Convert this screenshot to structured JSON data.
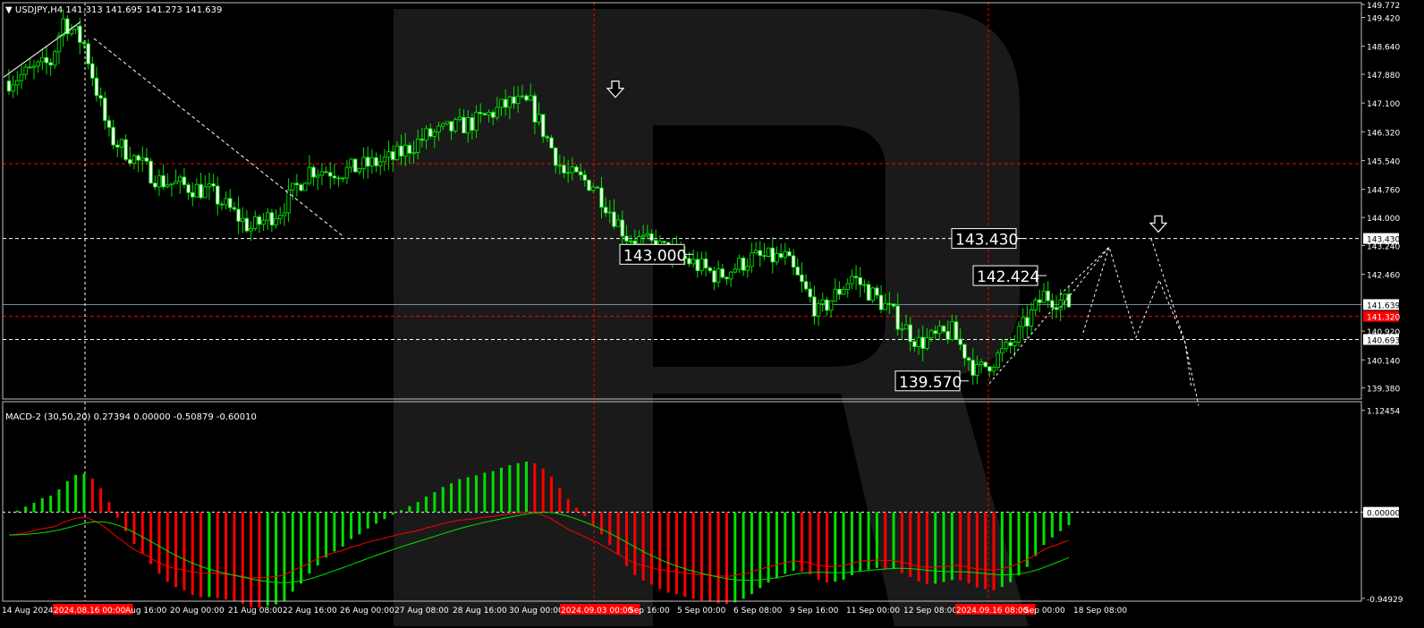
{
  "chart_title": "USDJPY,H4",
  "ohlc": {
    "open": "141.313",
    "high": "141.695",
    "low": "141.273",
    "close": "141.639"
  },
  "macd_label": "MACD-2 (30,50,20)",
  "macd_values": [
    "0.27394",
    "0.00000",
    "-0.50879",
    "-0.60010"
  ],
  "chart_data": [
    {
      "type": "candlestick",
      "title": "USDJPY,H4",
      "x_labels": [
        "14 Aug 2024",
        "2024.08.16 00:00",
        "Aug 16:00",
        "20 Aug 00:00",
        "21 Aug 08:00",
        "22 Aug 16:00",
        "26 Aug 00:00",
        "27 Aug 08:00",
        "28 Aug 16:00",
        "30 Aug 00:00",
        "2024.09.03 00:00",
        "Sep 16:00",
        "5 Sep 00:00",
        "6 Sep 08:00",
        "9 Sep 16:00",
        "11 Sep 00:00",
        "12 Sep 08:00",
        "2024.09.16 08:00",
        "Sep 00:00",
        "18 Sep 08:00"
      ],
      "y_ticks": [
        "149.772",
        "149.420",
        "148.640",
        "147.880",
        "147.100",
        "146.320",
        "145.540",
        "144.760",
        "144.000",
        "143.430",
        "143.240",
        "142.460",
        "141.639",
        "141.320",
        "140.920",
        "140.693",
        "140.140",
        "139.380"
      ],
      "ylim": [
        139.08,
        149.82
      ],
      "price_levels": [
        {
          "value": 145.457,
          "label": "145.457",
          "style": "red-dashed",
          "badge": "red"
        },
        {
          "value": 143.43,
          "label": "143.430",
          "style": "white-dashed",
          "badge": "white"
        },
        {
          "value": 141.639,
          "label": "141.639",
          "style": "grey-solid",
          "badge": "white"
        },
        {
          "value": 141.32,
          "label": "141.320",
          "style": "red-dashed",
          "badge": "red"
        },
        {
          "value": 140.693,
          "label": "140.693",
          "style": "white-dashed",
          "badge": "white"
        }
      ],
      "annotations": [
        {
          "text": "143.000",
          "price": 143.0
        },
        {
          "text": "143.430",
          "price": 143.43
        },
        {
          "text": "142.424",
          "price": 142.424
        },
        {
          "text": "139.570",
          "price": 139.57
        }
      ],
      "down_arrows": [
        {
          "price": 147.45
        },
        {
          "price": 143.8
        }
      ],
      "trend_lines": [
        {
          "from_price": 147.8,
          "to_price": 149.3
        },
        {
          "from_price": 148.85,
          "to_price": 143.5
        }
      ],
      "forecast_path": [
        141.55,
        143.2,
        140.75,
        142.3,
        140.6,
        138.9
      ],
      "forecast_path_2": [
        143.43,
        140.6,
        139.38
      ],
      "vlines": [
        "2024.08.16 00:00",
        "2024.09.03 00:00",
        "2024.09.16 08:00"
      ],
      "candles": []
    },
    {
      "type": "bar",
      "title": "MACD-2 (30,50,20)",
      "y_ticks": [
        "1.12454",
        "0.00000",
        "-0.94929"
      ],
      "ylim": [
        -0.98,
        1.22
      ],
      "histogram": [],
      "signal": []
    }
  ],
  "colors": {
    "bull": "#00e000",
    "bear": "#ff0000",
    "bg": "#000000",
    "grid": "#c0c0c0",
    "signal_red": "#ff0000",
    "signal_green": "#00e000"
  }
}
